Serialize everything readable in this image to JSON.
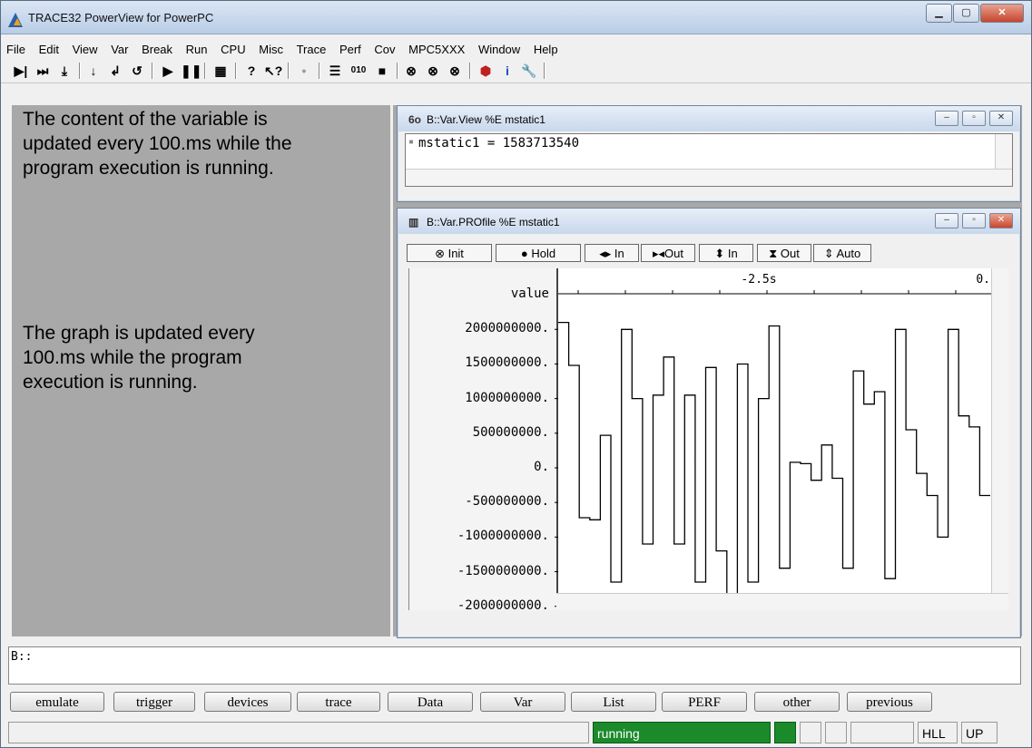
{
  "window": {
    "title": "TRACE32 PowerView for PowerPC"
  },
  "menu": [
    "File",
    "Edit",
    "View",
    "Var",
    "Break",
    "Run",
    "CPU",
    "Misc",
    "Trace",
    "Perf",
    "Cov",
    "MPC5XXX",
    "Window",
    "Help"
  ],
  "notes": {
    "top": "The content of the variable is\nupdated every 100.ms while the\nprogram execution is running.",
    "middle": "The graph is updated every\n100.ms while the program\nexecution is running."
  },
  "varview": {
    "title": "B::Var.View %E mstatic1",
    "line": "mstatic1 = 1583713540"
  },
  "profile": {
    "title": "B::Var.PROfile %E mstatic1",
    "buttons": [
      "Init",
      "Hold",
      "In",
      "Out",
      "In",
      "Out",
      "Auto"
    ],
    "button_icons": [
      "init-icon",
      "hold-icon",
      "zoom-horizontal-in-icon",
      "zoom-horizontal-out-icon",
      "zoom-vertical-in-icon",
      "zoom-vertical-out-icon",
      "auto-scale-icon"
    ],
    "value_header": "value",
    "time_labels": [
      "-2.5s",
      "0."
    ],
    "y_tick_labels": [
      "2000000000.",
      "1500000000.",
      "1000000000.",
      "500000000.",
      "0.",
      "-500000000.",
      "-1000000000.",
      "-1500000000.",
      "-2000000000."
    ]
  },
  "chart_data": {
    "type": "line",
    "step": true,
    "series": [
      {
        "values": [
          2100000000,
          1480000000,
          -720000000,
          -750000000,
          470000000,
          -1650000000,
          2000000000,
          1000000000,
          -1100000000,
          1050000000,
          1600000000,
          -1100000000,
          1050000000,
          -1650000000,
          1450000000,
          -1200000000,
          -2000000000,
          1500000000,
          -1650000000,
          1000000000,
          2050000000,
          -1450000000,
          80000000,
          60000000,
          -180000000,
          330000000,
          -150000000,
          -1450000000,
          1400000000,
          920000000,
          1100000000,
          -1600000000,
          2000000000,
          550000000,
          -80000000,
          -400000000,
          -1000000000,
          2000000000,
          750000000,
          590000000,
          -400000000
        ]
      }
    ],
    "y_tick_labels": [
      "2000000000.",
      "1500000000.",
      "1000000000.",
      "500000000.",
      "0.",
      "-500000000.",
      "-1000000000.",
      "-1500000000.",
      "-2000000000."
    ],
    "x_tick_labels": [
      "-2.5s",
      "0."
    ],
    "ylim": [
      -2200000000,
      2200000000
    ]
  },
  "commandline": {
    "prompt": "B::"
  },
  "softkeys": [
    "emulate",
    "trigger",
    "devices",
    "trace",
    "Data",
    "Var",
    "List",
    "PERF",
    "other",
    "previous"
  ],
  "status": {
    "state": "running",
    "mode": "HLL",
    "direction": "UP"
  },
  "colors": {
    "running": "#1a8a2a"
  }
}
